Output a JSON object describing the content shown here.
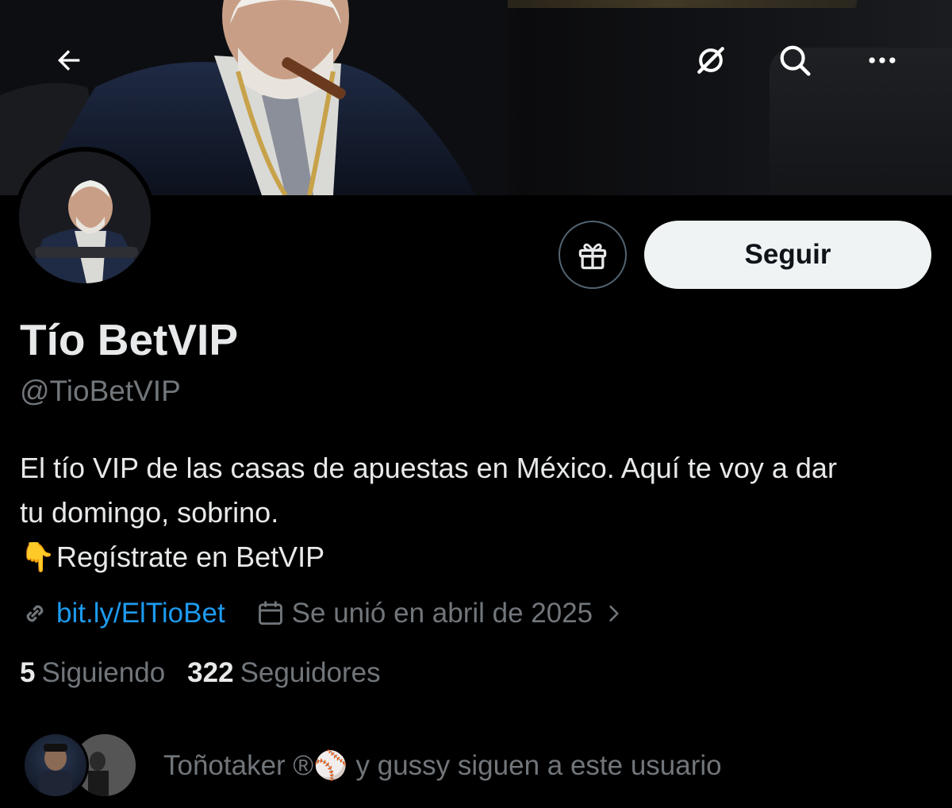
{
  "header": {
    "back_icon": "arrow-left-icon",
    "grok_icon": "grok-icon",
    "search_icon": "search-icon",
    "more_icon": "more-horizontal-icon"
  },
  "profile": {
    "display_name": "Tío BetVIP",
    "handle": "@TioBetVIP",
    "bio_line1": "El tío VIP de las casas de apuestas en México. Aquí te voy a dar",
    "bio_line2": "tu domingo, sobrino.",
    "bio_line3_emoji": "👇",
    "bio_line3_text": "Regístrate en BetVIP",
    "link_text": "bit.ly/ElTioBet",
    "joined_text": "Se unió en abril de 2025",
    "following_count": "5",
    "following_label": "Siguiendo",
    "followers_count": "322",
    "followers_label": "Seguidores"
  },
  "actions": {
    "follow_label": "Seguir",
    "gift_icon": "gift-icon"
  },
  "followed_by": {
    "text": "Toñotaker ®⚾ y gussy siguen a este usuario"
  },
  "colors": {
    "background": "#000000",
    "text_primary": "#e7e9ea",
    "text_secondary": "#71767b",
    "link": "#1d9bf0",
    "follow_button_bg": "#eff3f4"
  }
}
